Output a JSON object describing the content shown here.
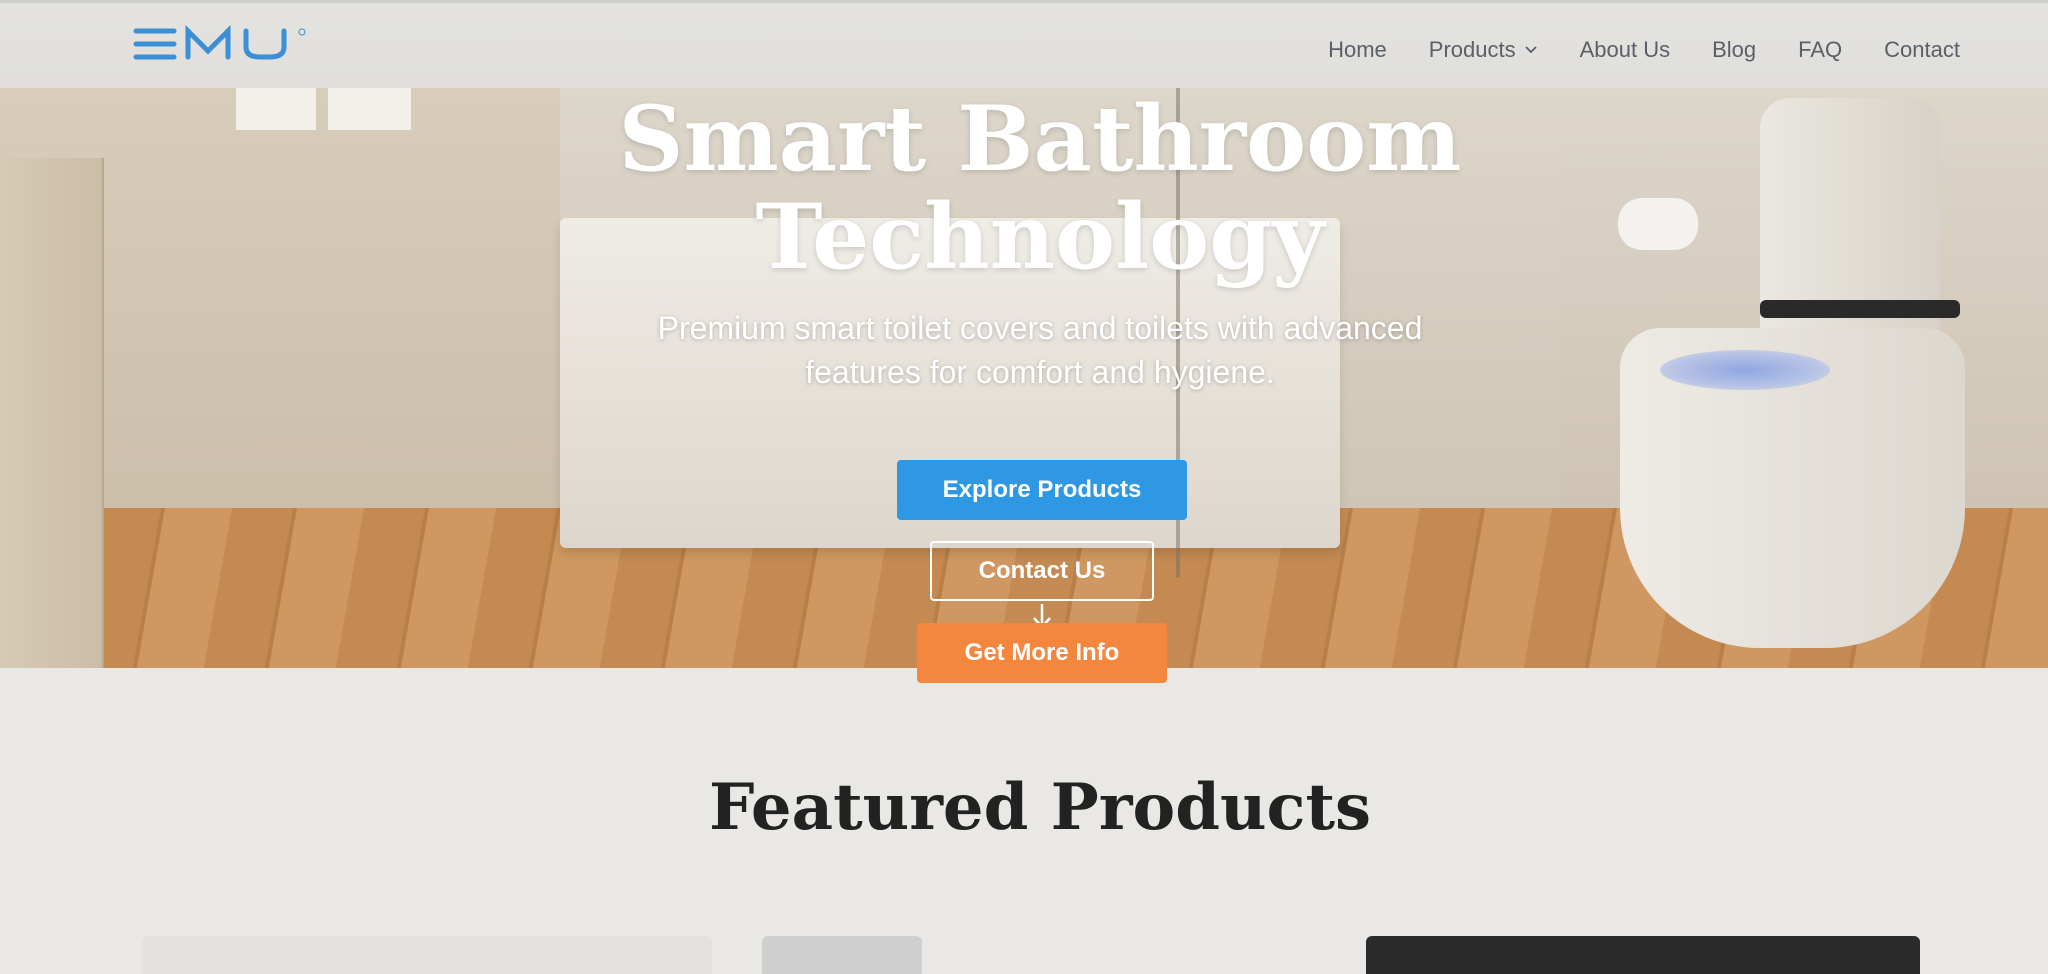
{
  "header": {
    "logo_text": "EMU",
    "nav": [
      {
        "label": "Home"
      },
      {
        "label": "Products",
        "has_dropdown": true
      },
      {
        "label": "About Us"
      },
      {
        "label": "Blog"
      },
      {
        "label": "FAQ"
      },
      {
        "label": "Contact"
      }
    ]
  },
  "hero": {
    "title_line1": "Smart Bathroom",
    "title_line2": "Technology",
    "subtitle_line1": "Premium smart toilet covers and toilets with advanced",
    "subtitle_line2": "features for comfort and hygiene.",
    "primary_button": "Explore Products",
    "secondary_button": "Contact Us",
    "tertiary_button": "Get More Info"
  },
  "featured": {
    "title": "Featured Products"
  },
  "colors": {
    "primary": "#2f98e4",
    "accent": "#f4873e",
    "logo": "#3a8fd6"
  }
}
